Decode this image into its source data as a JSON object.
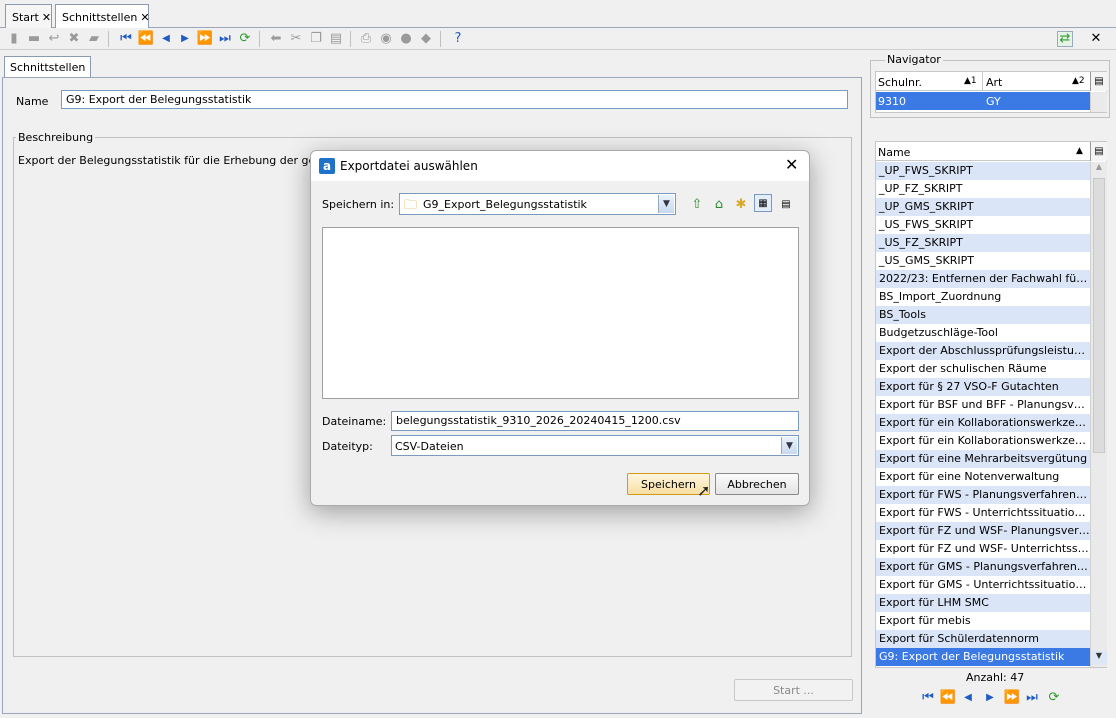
{
  "tabs": [
    {
      "label": "Start",
      "close": "✕"
    },
    {
      "label": "Schnittstellen",
      "close": "✕"
    }
  ],
  "toolbar": {
    "icons": [
      "new-icon",
      "save-icon",
      "undo-icon",
      "delete-icon",
      "comment-icon",
      "first-icon",
      "prev-page-icon",
      "prev-icon",
      "next-icon",
      "next-page-icon",
      "last-icon",
      "refresh-icon",
      "back-icon",
      "cut-icon",
      "copy-icon",
      "paste-icon",
      "print-icon",
      "preview-icon",
      "hint-icon",
      "erase-icon",
      "help-icon"
    ],
    "window_close": "✕"
  },
  "subtab": {
    "label": "Schnittstellen"
  },
  "form": {
    "name_label": "Name",
    "name_value": "G9: Export der Belegungsstatistik",
    "description_legend": "Beschreibung",
    "description_text": "Export der Belegungsstatistik für die Erhebung der geplanten",
    "start_button": "Start ..."
  },
  "navigator": {
    "title": "Navigator",
    "top_grid": {
      "columns": [
        {
          "label": "Schulnr.",
          "sort": "▲1"
        },
        {
          "label": "Art",
          "sort": "▲2"
        }
      ],
      "rows": [
        {
          "schulnr": "9310",
          "art": "GY"
        }
      ]
    },
    "list": {
      "column": "Name",
      "sort": "▲",
      "items": [
        "_UP_FWS_SKRIPT",
        "_UP_FZ_SKRIPT",
        "_UP_GMS_SKRIPT",
        "_US_FWS_SKRIPT",
        "_US_FZ_SKRIPT",
        "_US_GMS_SKRIPT",
        "2022/23: Entfernen der Fachwahl für F...",
        "BS_Import_Zuordnung",
        "BS_Tools",
        "Budgetzuschläge-Tool",
        "Export der Abschlussprüfungsleistung...",
        "Export der schulischen Räume",
        "Export für § 27 VSO-F Gutachten",
        "Export für BSF und BFF - Planungsverfa...",
        "Export für ein Kollaborationswerkzeug ...",
        "Export für ein Kollaborationswerkzeug ...",
        "Export für eine Mehrarbeitsvergütung",
        "Export für eine Notenverwaltung",
        "Export für FWS - Planungsverfahren (St...",
        "Export für FWS - Unterrichtssituation  (...",
        "Export für FZ und WSF- Planungsverfa...",
        "Export für FZ und WSF- Unterrichtssitu...",
        "Export für GMS - Planungsverfahren  (S...",
        "Export für GMS - Unterrichtssituation (...",
        "Export für LHM SMC",
        "Export für mebis",
        "Export für Schülerdatennorm",
        "G9: Export der Belegungsstatistik"
      ],
      "selected_index": 27
    },
    "count": "Anzahl: 47"
  },
  "dialog": {
    "title": "Exportdatei auswählen",
    "close": "✕",
    "save_in_label": "Speichern in:",
    "save_in_value": "G9_Export_Belegungsstatistik",
    "filename_label": "Dateiname:",
    "filename_value": "belegungsstatistik_9310_2026_20240415_1200.csv",
    "filetype_label": "Dateityp:",
    "filetype_value": "CSV-Dateien",
    "save_button": "Speichern",
    "cancel_button": "Abbrechen"
  }
}
